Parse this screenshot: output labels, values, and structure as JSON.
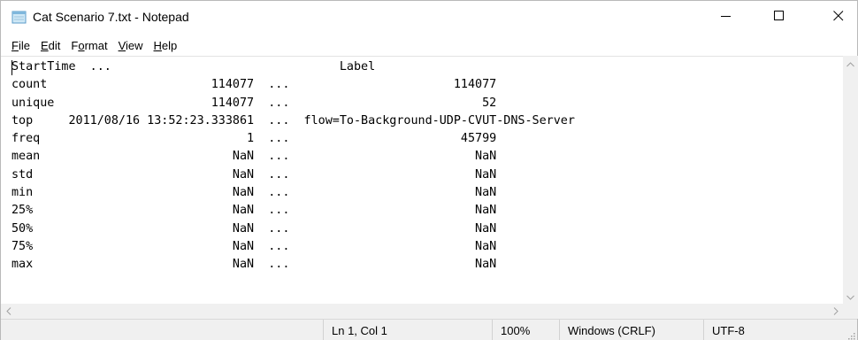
{
  "window": {
    "title": "Cat Scenario 7.txt - Notepad",
    "icons": {
      "app": "notepad-icon",
      "minimize": "minimize-icon",
      "maximize": "maximize-icon",
      "close": "close-icon"
    }
  },
  "menu": {
    "items": [
      {
        "label": "File",
        "access_key": "F",
        "rest": "ile"
      },
      {
        "label": "Edit",
        "access_key": "E",
        "rest": "dit"
      },
      {
        "label": "Format",
        "access_key": "o",
        "pre": "F",
        "rest": "rmat"
      },
      {
        "label": "View",
        "access_key": "V",
        "rest": "iew"
      },
      {
        "label": "Help",
        "access_key": "H",
        "rest": "elp"
      }
    ]
  },
  "editor": {
    "content": "StartTime  ...                                Label\ncount                       114077  ...                       114077\nunique                      114077  ...                           52\ntop     2011/08/16 13:52:23.333861  ...  flow=To-Background-UDP-CVUT-DNS-Server\nfreq                             1  ...                        45799\nmean                           NaN  ...                          NaN\nstd                            NaN  ...                          NaN\nmin                            NaN  ...                          NaN\n25%                            NaN  ...                          NaN\n50%                            NaN  ...                          NaN\n75%                            NaN  ...                          NaN\nmax                            NaN  ...                          NaN"
  },
  "statusbar": {
    "position": "Ln 1, Col 1",
    "zoom": "100%",
    "line_ending": "Windows (CRLF)",
    "encoding": "UTF-8"
  }
}
